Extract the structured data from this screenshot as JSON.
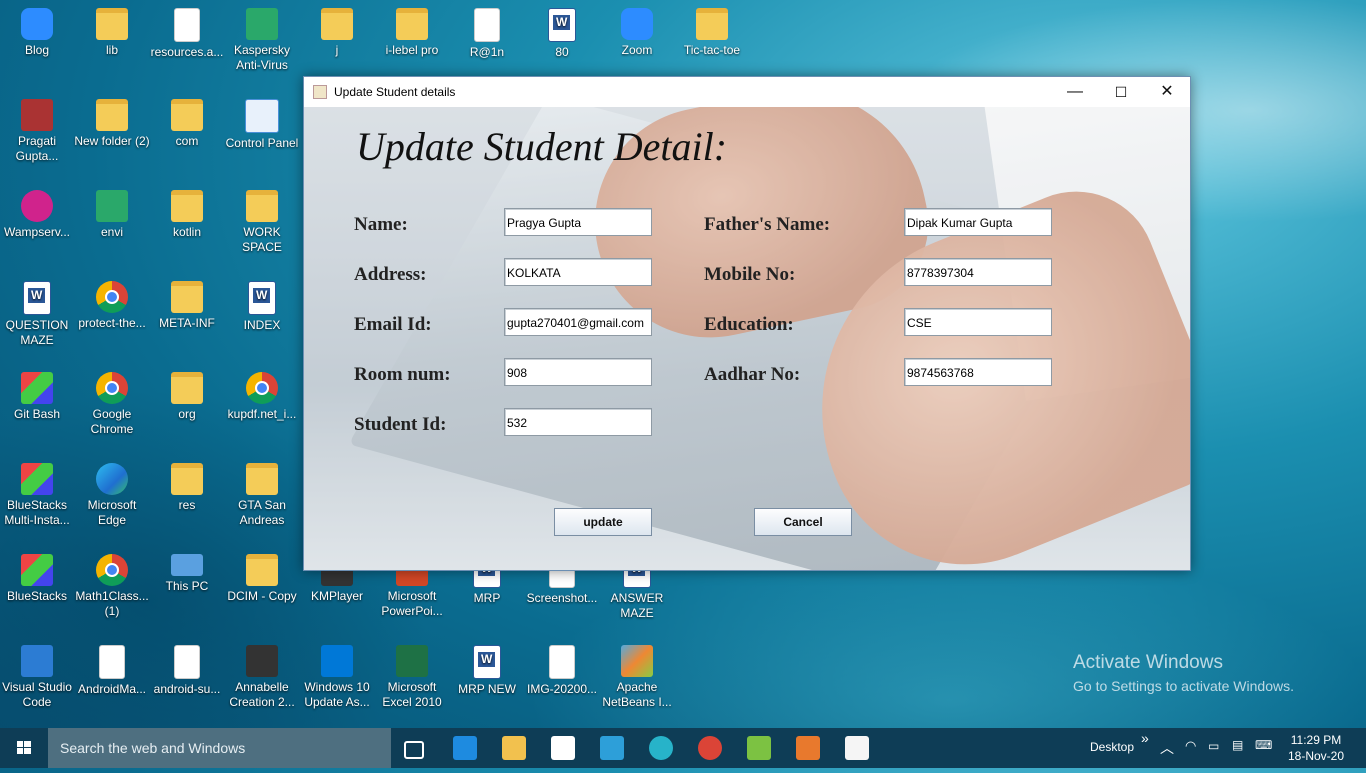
{
  "desktop": {
    "icons": [
      {
        "label": "Blog",
        "icon": "edge-legacy-icon"
      },
      {
        "label": "lib",
        "icon": "folder-icon"
      },
      {
        "label": "resources.a...",
        "icon": "document-icon"
      },
      {
        "label": "Kaspersky Anti-Virus",
        "icon": "kaspersky-icon"
      },
      {
        "label": "j",
        "icon": "folder-icon"
      },
      {
        "label": "i-lebel pro",
        "icon": "folder-icon"
      },
      {
        "label": "R@1n",
        "icon": "document-icon"
      },
      {
        "label": "80",
        "icon": "word-icon"
      },
      {
        "label": "Zoom",
        "icon": "zoom-icon"
      },
      {
        "label": "Tic-tac-toe",
        "icon": "folder-icon"
      },
      {
        "label": "Pragati Gupta...",
        "icon": "winrar-icon"
      },
      {
        "label": "New folder (2)",
        "icon": "folder-icon"
      },
      {
        "label": "com",
        "icon": "folder-icon"
      },
      {
        "label": "Control Panel",
        "icon": "control-panel-icon"
      },
      {
        "label": "Wampserv...",
        "icon": "wampserver-icon"
      },
      {
        "label": "envi",
        "icon": "recycle-icon"
      },
      {
        "label": "kotlin",
        "icon": "folder-icon"
      },
      {
        "label": "WORK SPACE",
        "icon": "folder-icon"
      },
      {
        "label": "QUESTION MAZE",
        "icon": "word-icon"
      },
      {
        "label": "protect-the...",
        "icon": "chrome-icon"
      },
      {
        "label": "META-INF",
        "icon": "folder-icon"
      },
      {
        "label": "INDEX",
        "icon": "word-icon"
      },
      {
        "label": "Git Bash",
        "icon": "git-bash-icon"
      },
      {
        "label": "Google Chrome",
        "icon": "chrome-icon"
      },
      {
        "label": "org",
        "icon": "folder-icon"
      },
      {
        "label": "kupdf.net_i...",
        "icon": "chrome-icon"
      },
      {
        "label": "BlueStacks Multi-Insta...",
        "icon": "bluestacks-icon"
      },
      {
        "label": "Microsoft Edge",
        "icon": "edge-icon"
      },
      {
        "label": "res",
        "icon": "folder-icon"
      },
      {
        "label": "GTA San Andreas",
        "icon": "folder-icon"
      },
      {
        "label": "BlueStacks",
        "icon": "bluestacks-icon"
      },
      {
        "label": "Math1Class... (1)",
        "icon": "chrome-icon"
      },
      {
        "label": "This PC",
        "icon": "this-pc-icon"
      },
      {
        "label": "DCIM - Copy",
        "icon": "folder-icon"
      },
      {
        "label": "KMPlayer",
        "icon": "kmplayer-icon"
      },
      {
        "label": "Microsoft PowerPoi...",
        "icon": "powerpoint-icon"
      },
      {
        "label": "MRP",
        "icon": "word-icon"
      },
      {
        "label": "Screenshot...",
        "icon": "image-icon"
      },
      {
        "label": "ANSWER MAZE",
        "icon": "word-icon"
      },
      {
        "label": "Visual Studio Code",
        "icon": "vscode-icon"
      },
      {
        "label": "AndroidMa...",
        "icon": "document-icon"
      },
      {
        "label": "android-su...",
        "icon": "document-icon"
      },
      {
        "label": "Annabelle Creation 2...",
        "icon": "video-icon"
      },
      {
        "label": "Windows 10 Update As...",
        "icon": "windows-update-icon"
      },
      {
        "label": "Microsoft Excel 2010",
        "icon": "excel-icon"
      },
      {
        "label": "MRP NEW",
        "icon": "word-icon"
      },
      {
        "label": "IMG-20200...",
        "icon": "image-icon"
      },
      {
        "label": "Apache NetBeans I...",
        "icon": "netbeans-icon"
      }
    ]
  },
  "window": {
    "title": "Update Student details",
    "minimize": "—",
    "maximize": "☐",
    "close": "✕",
    "heading": "Update Student Detail:",
    "fields": {
      "name": {
        "label": "Name:",
        "value": "Pragya Gupta"
      },
      "father": {
        "label": "Father's Name:",
        "value": "Dipak Kumar Gupta"
      },
      "address": {
        "label": "Address:",
        "value": "KOLKATA"
      },
      "mobile": {
        "label": "Mobile No:",
        "value": "8778397304"
      },
      "email": {
        "label": "Email Id:",
        "value": "gupta270401@gmail.com"
      },
      "education": {
        "label": "Education:",
        "value": "CSE"
      },
      "room": {
        "label": "Room num:",
        "value": "908"
      },
      "aadhar": {
        "label": "Aadhar No:",
        "value": "9874563768"
      },
      "student_id": {
        "label": "Student Id:",
        "value": "532"
      }
    },
    "buttons": {
      "update": "update",
      "cancel": "Cancel"
    }
  },
  "watermark": {
    "line1": "Activate Windows",
    "line2": "Go to Settings to activate Windows."
  },
  "taskbar": {
    "search_placeholder": "Search the web and Windows",
    "desktop_label": "Desktop",
    "overflow": "»",
    "time": "11:29 PM",
    "date": "18-Nov-20",
    "pinned": [
      "task-view-icon",
      "edge-legacy-icon",
      "file-explorer-icon",
      "store-icon",
      "settings-icon",
      "edge-icon",
      "chrome-icon",
      "bluestacks-icon",
      "netbeans-icon",
      "java-icon"
    ],
    "colors": {
      "bar": "#0e3d56",
      "search": "#4e6f80"
    }
  }
}
